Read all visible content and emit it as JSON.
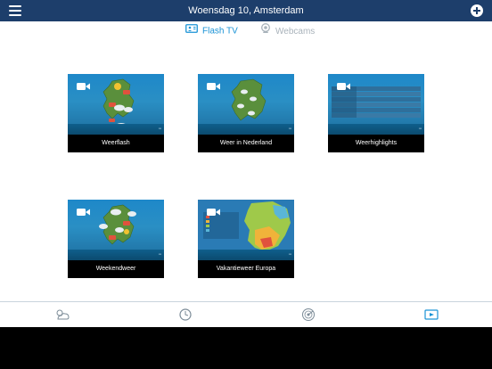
{
  "header": {
    "title": "Woensdag 10, Amsterdam"
  },
  "tabs": [
    {
      "label": "Flash TV",
      "active": true
    },
    {
      "label": "Webcams",
      "active": false
    }
  ],
  "tiles": [
    {
      "label": "Weerflash"
    },
    {
      "label": "Weer in Nederland"
    },
    {
      "label": "Weerhighlights"
    },
    {
      "label": "Weekendweer"
    },
    {
      "label": "Vakantieweer Europa"
    }
  ],
  "colors": {
    "topbar": "#1d3e6b",
    "active_tab": "#1a93d6",
    "inactive_tab": "#a9b3bb"
  },
  "bottom_nav": [
    {
      "icon": "weather-cloud-sun-icon"
    },
    {
      "icon": "forecast-clock-icon"
    },
    {
      "icon": "radar-icon"
    },
    {
      "icon": "flash-tv-icon",
      "active": true
    }
  ]
}
